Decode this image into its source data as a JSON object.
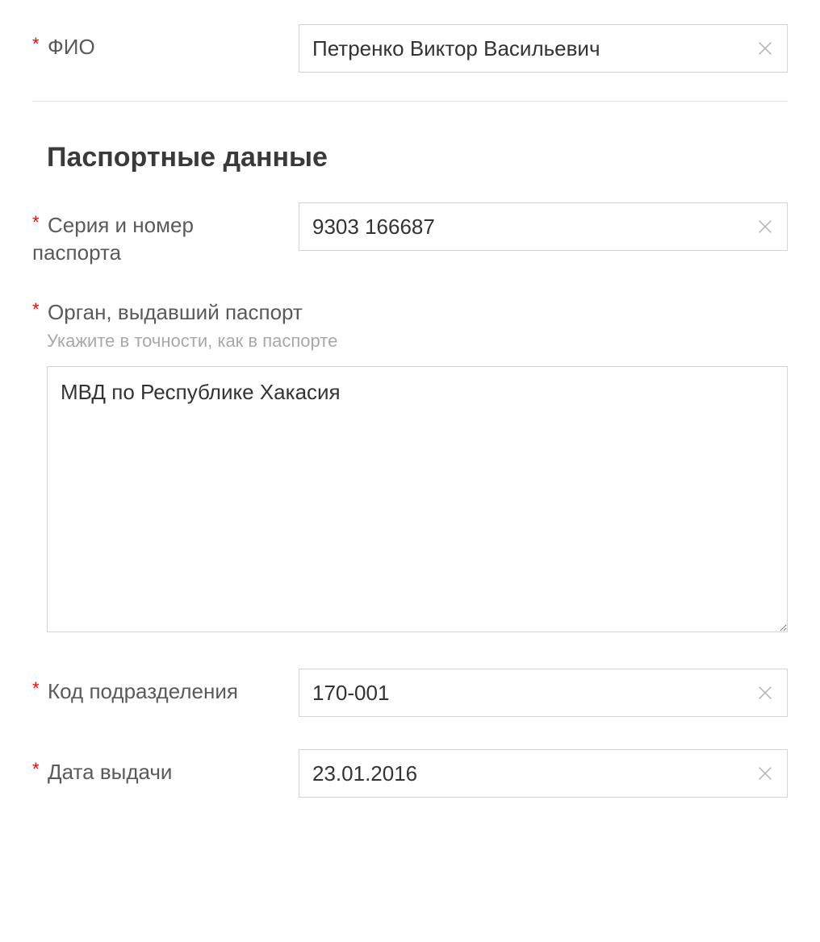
{
  "fio": {
    "label": "ФИО",
    "value": "Петренко Виктор Васильевич"
  },
  "passport": {
    "section_title": "Паспортные данные",
    "series_number": {
      "label": "Серия и номер паспорта",
      "value": "9303 166687"
    },
    "issued_by": {
      "label": "Орган, выдавший паспорт",
      "hint": "Укажите в точности, как в паспорте",
      "value": "МВД по Республике Хакасия"
    },
    "division_code": {
      "label": "Код подразделения",
      "value": "170-001"
    },
    "issue_date": {
      "label": "Дата выдачи",
      "value": "23.01.2016"
    }
  },
  "required_mark": "*"
}
